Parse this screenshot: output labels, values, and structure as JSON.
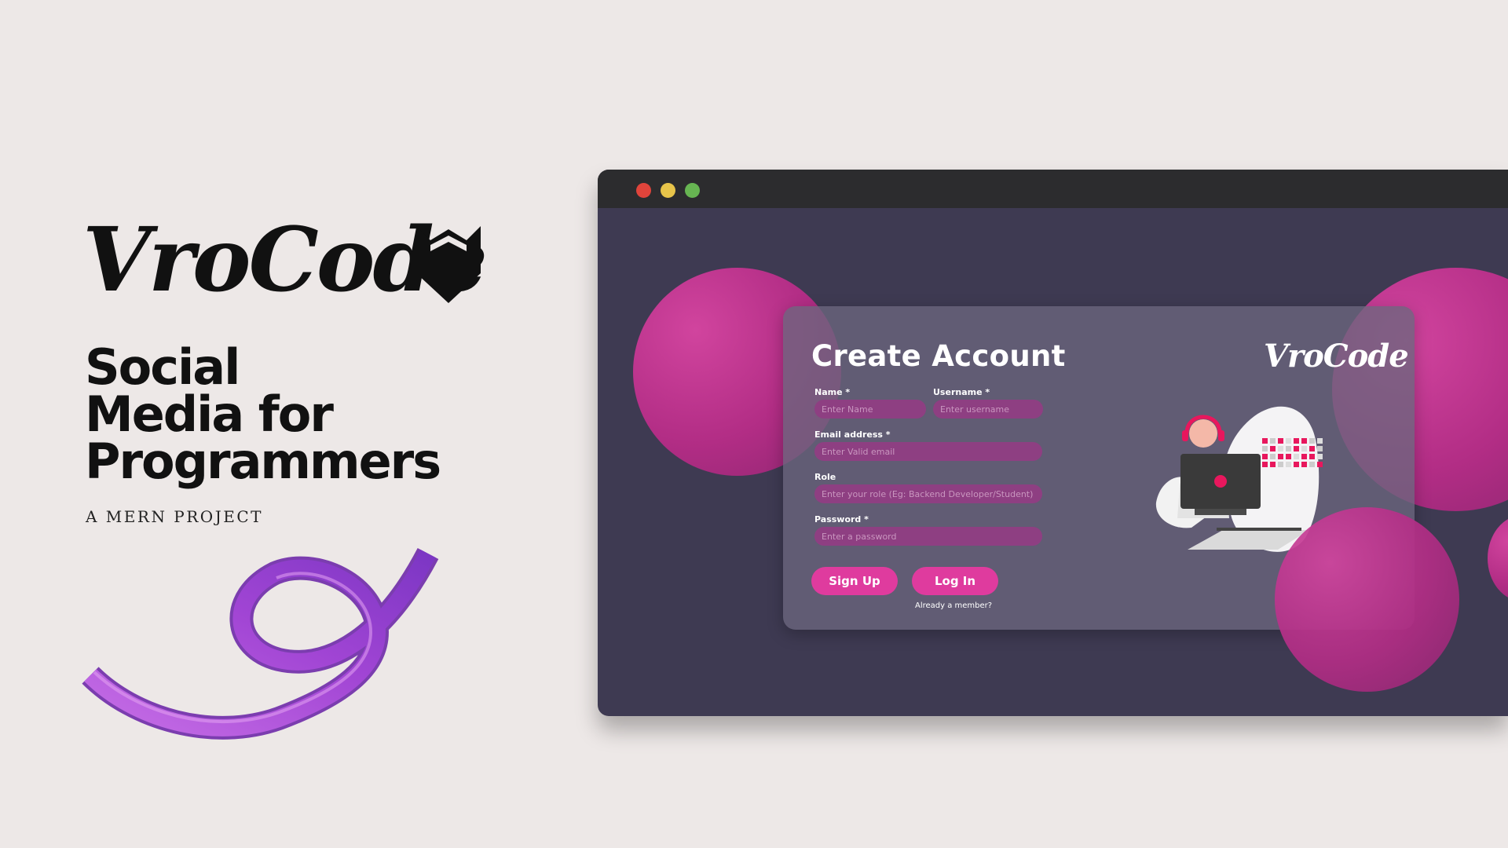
{
  "promo": {
    "brand_name": "VroCode",
    "headline_lines": [
      "Social",
      "Media for",
      "Programmers"
    ],
    "subtitle": "A MERN PROJECT"
  },
  "icons": {
    "brand_mark": "double-chevron-down-icon",
    "decoration": "purple-swirl-ribbon",
    "window_controls": [
      "close-dot",
      "minimize-dot",
      "maximize-dot"
    ],
    "illustration": "person-with-headphones-at-laptop"
  },
  "colors": {
    "page_bg": "#ede8e7",
    "app_bg": "#3e3a52",
    "titlebar": "#2c2c2e",
    "accent_pink": "#df3b9e",
    "input_bg": "#8e3f82",
    "blob": "#b22d85",
    "swirl": "#a145d4"
  },
  "signup_form": {
    "title": "Create Account",
    "logo": "VroCode",
    "fields": {
      "name": {
        "label": "Name *",
        "placeholder": "Enter Name"
      },
      "username": {
        "label": "Username *",
        "placeholder": "Enter username"
      },
      "email": {
        "label": "Email address *",
        "placeholder": "Enter Valid email"
      },
      "role": {
        "label": "Role",
        "placeholder": "Enter your role (Eg: Backend Developer/Student)"
      },
      "password": {
        "label": "Password *",
        "placeholder": "Enter a password"
      }
    },
    "signup_label": "Sign Up",
    "login_label": "Log In",
    "already_member": "Already a member?"
  }
}
